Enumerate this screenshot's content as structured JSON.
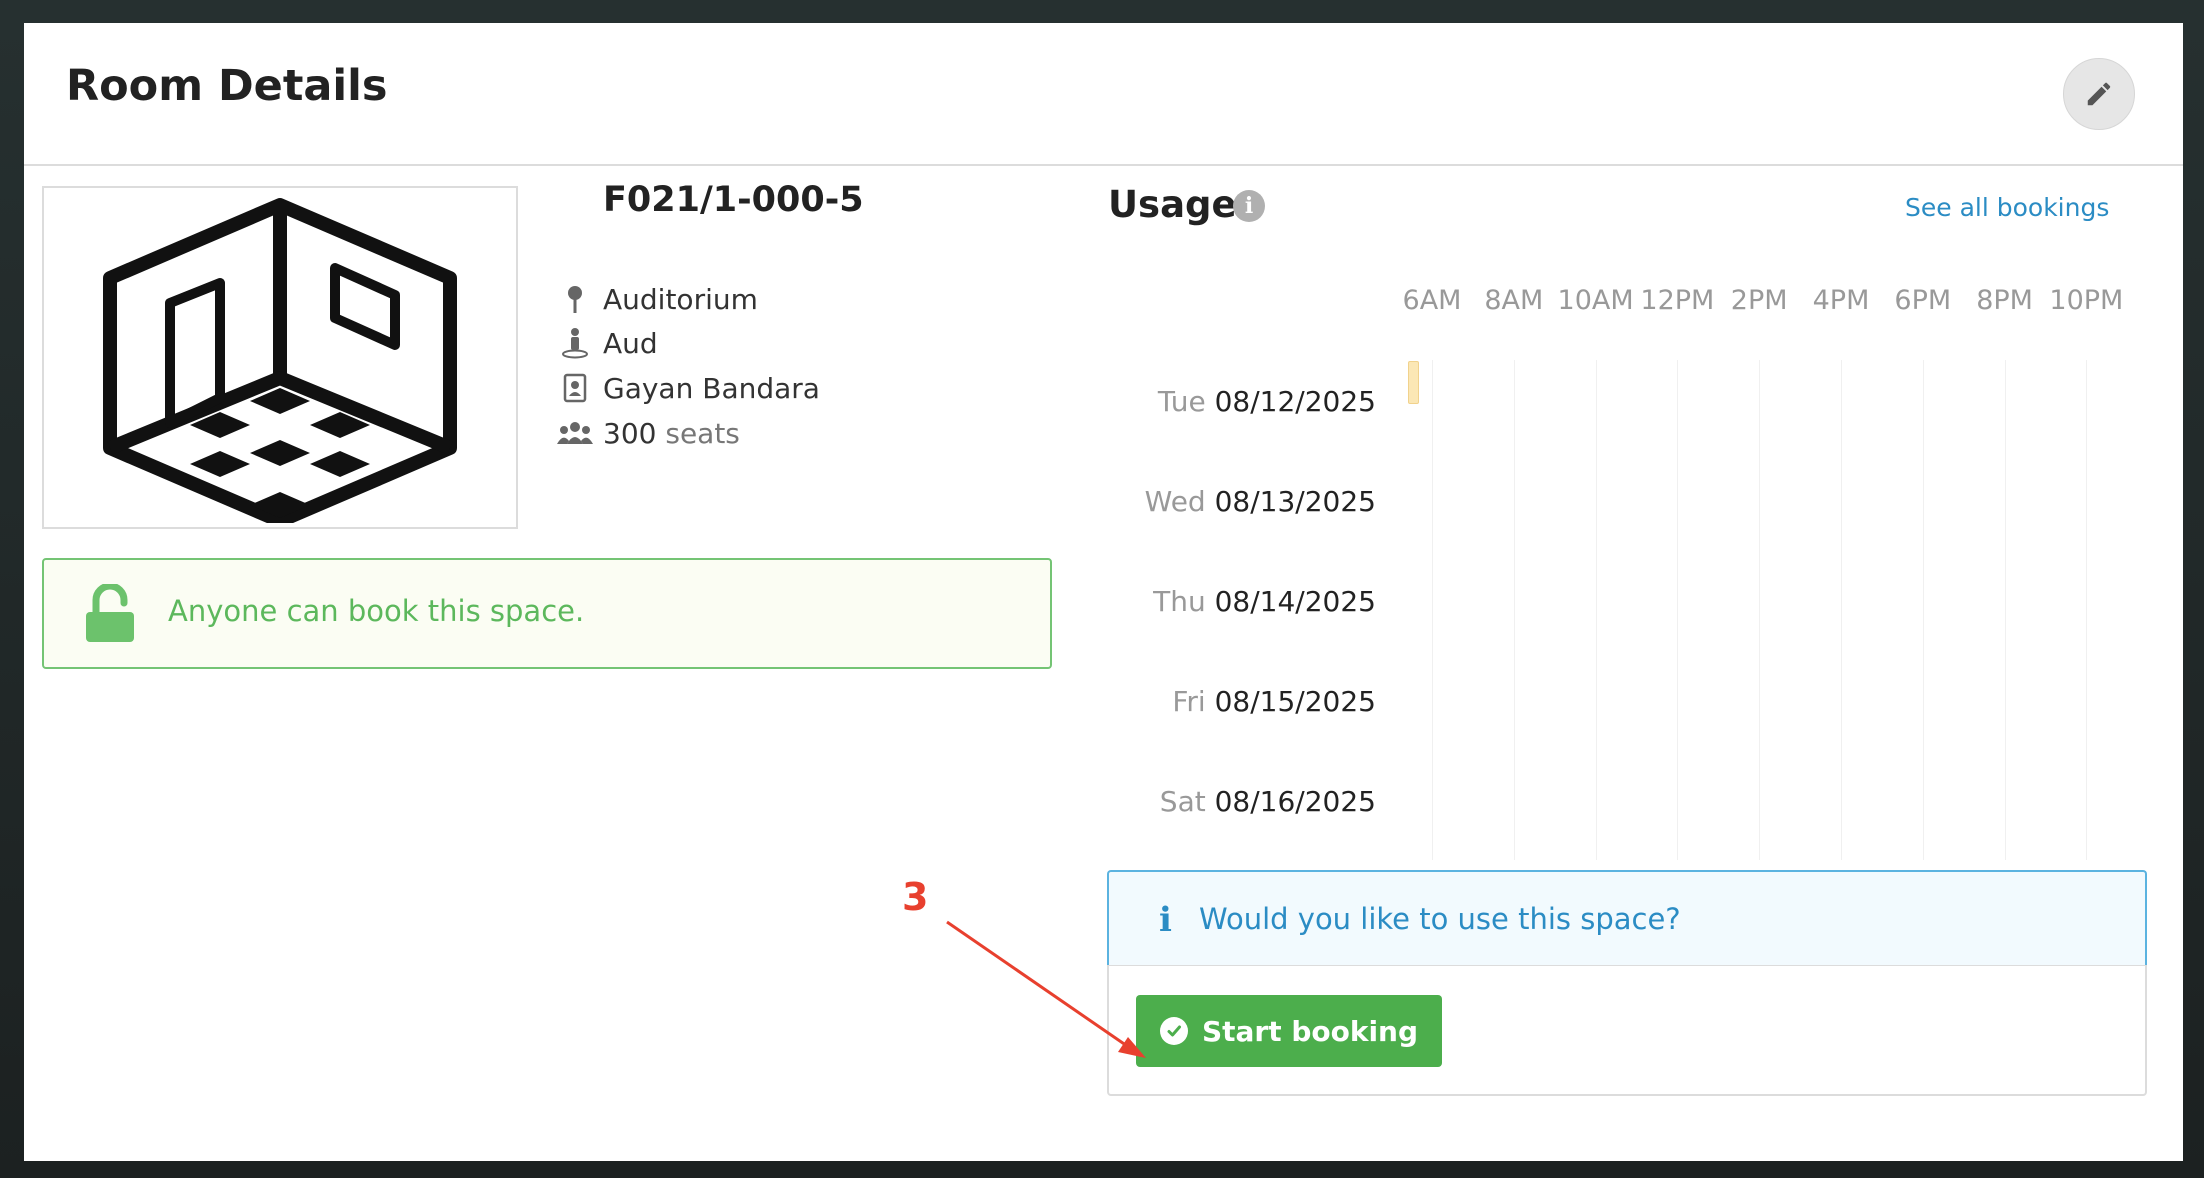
{
  "modal": {
    "title": "Room Details",
    "edit_icon": "pencil-icon"
  },
  "room": {
    "name": "F021/1-000-5",
    "image_icon": "room-isometric-icon",
    "details": {
      "building": "Auditorium",
      "floor": "Aud",
      "contact": "Gayan Bandara",
      "seats_number": "300",
      "seats_label": "seats"
    },
    "access": {
      "text": "Anyone can book this space.",
      "icon": "unlock-icon",
      "color": "#5cb85c"
    }
  },
  "usage": {
    "title": "Usage",
    "info_icon": "info-circle-icon",
    "see_all": "See all bookings",
    "hours": [
      "6AM",
      "8AM",
      "10AM",
      "12PM",
      "2PM",
      "4PM",
      "6PM",
      "8PM",
      "10PM"
    ],
    "days": [
      {
        "dow": "Tue",
        "date": "08/12/2025"
      },
      {
        "dow": "Wed",
        "date": "08/13/2025"
      },
      {
        "dow": "Thu",
        "date": "08/14/2025"
      },
      {
        "dow": "Fri",
        "date": "08/15/2025"
      },
      {
        "dow": "Sat",
        "date": "08/16/2025"
      }
    ]
  },
  "booking_prompt": {
    "question": "Would you like to use this space?",
    "button_label": "Start booking",
    "accent": "#2b8cc4",
    "button_color": "#4cae4c"
  },
  "annotation": {
    "number": "3",
    "color": "#e8402e"
  }
}
